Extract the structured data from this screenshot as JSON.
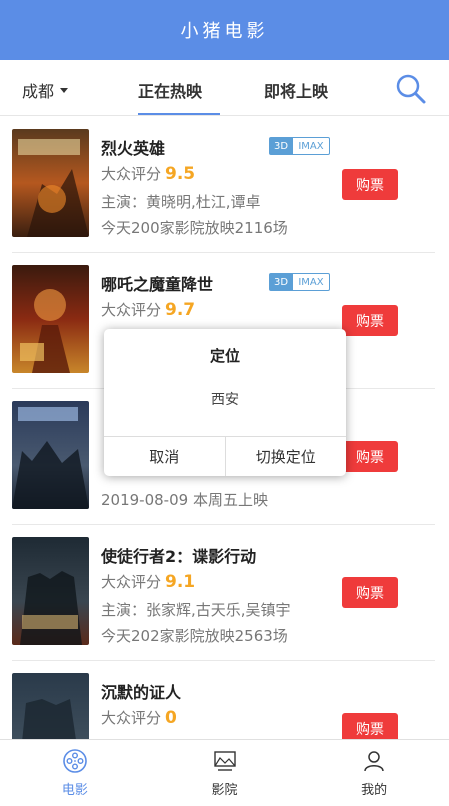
{
  "app": {
    "title": "小猪电影",
    "accent": "#5b8de6"
  },
  "topbar": {
    "city": "成都",
    "tabs": [
      {
        "label": "正在热映",
        "active": true
      },
      {
        "label": "即将上映",
        "active": false
      }
    ],
    "search_icon": "search-icon"
  },
  "movies": [
    {
      "title": "烈火英雄",
      "score_label": "大众评分",
      "score": "9.5",
      "actors": "主演：黄晓明,杜江,谭卓",
      "info": "今天200家影院放映2116场",
      "tags": [
        "3D",
        "IMAX"
      ],
      "buy": "购票"
    },
    {
      "title": "哪吒之魔童降世",
      "score_label": "大众评分",
      "score": "9.7",
      "actors": "",
      "info": "",
      "tags": [
        "3D",
        "IMAX"
      ],
      "buy": "购票"
    },
    {
      "title": "",
      "score_label": "",
      "score": "",
      "actors": "",
      "info": "2019-08-09 本周五上映",
      "tags": [],
      "buy": "购票"
    },
    {
      "title": "使徒行者2：谍影行动",
      "score_label": "大众评分",
      "score": "9.1",
      "actors": "主演：张家辉,古天乐,吴镇宇",
      "info": "今天202家影院放映2563场",
      "tags": [],
      "buy": "购票"
    },
    {
      "title": "沉默的证人",
      "score_label": "大众评分",
      "score": "0",
      "actors": "",
      "info": "",
      "tags": [],
      "buy": "购票"
    }
  ],
  "dialog": {
    "title": "定位",
    "message": "西安",
    "cancel": "取消",
    "confirm": "切换定位"
  },
  "bottom_nav": [
    {
      "label": "电影",
      "icon": "film-reel-icon",
      "active": true
    },
    {
      "label": "影院",
      "icon": "cinema-screen-icon",
      "active": false
    },
    {
      "label": "我的",
      "icon": "user-icon",
      "active": false
    }
  ],
  "colors": {
    "buy_button": "#ef3b3b",
    "score": "#f5a623",
    "tag": "#5b9fd6"
  }
}
